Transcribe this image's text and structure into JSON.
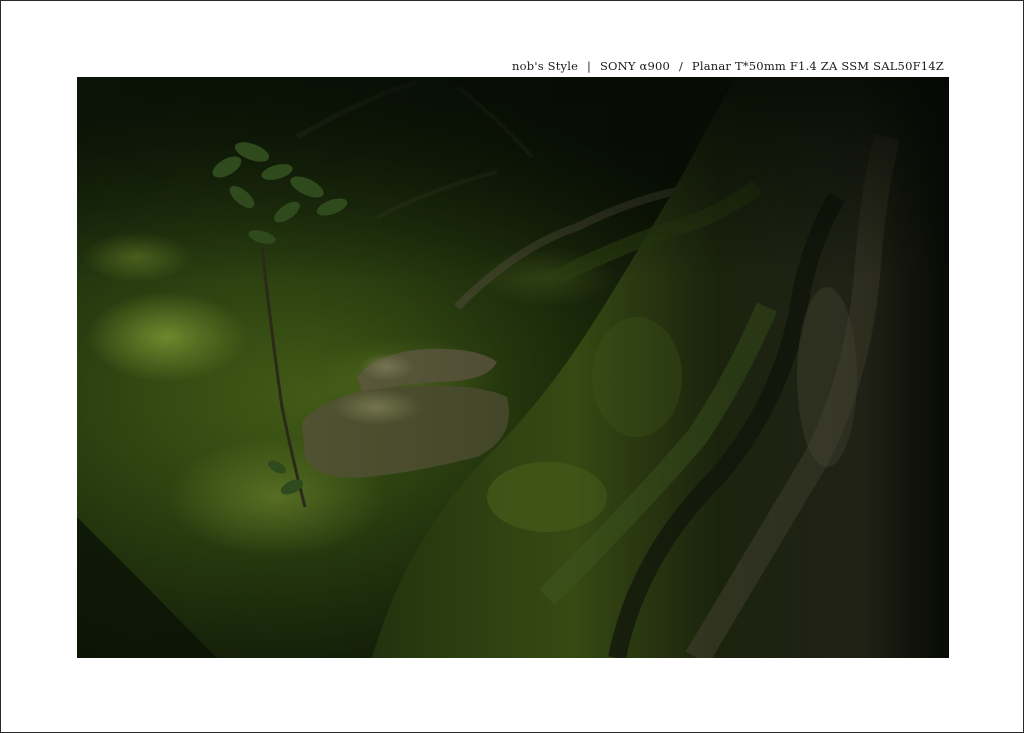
{
  "caption": {
    "author": "nob's Style",
    "sep1": "|",
    "camera": "SONY α900",
    "sep2": "/",
    "lens": "Planar T*50mm F1.4 ZA SSM  SAL50F14Z"
  },
  "photo": {
    "subject": "moss-covered-tree-roots",
    "colors": {
      "shadow": "#0c1508",
      "moss_dark": "#22340f",
      "moss_mid": "#3f5a18",
      "moss_light": "#6f8f2a",
      "root_shadow": "#1c2412",
      "root_lit": "#7d7d52",
      "bark": "#4a4a32"
    }
  }
}
